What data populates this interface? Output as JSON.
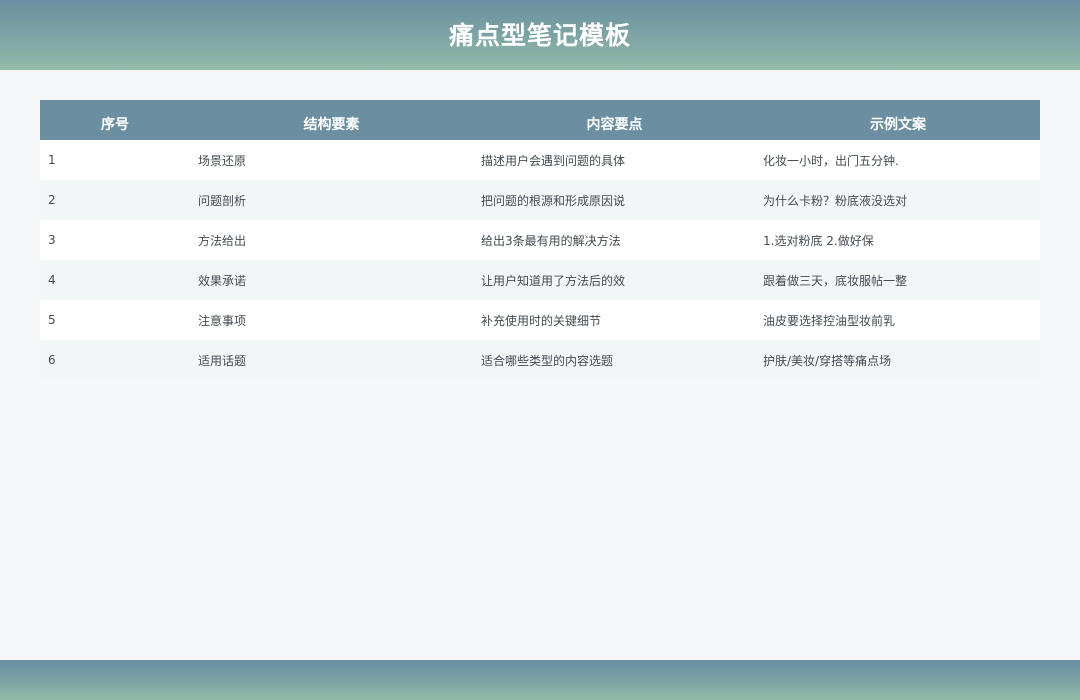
{
  "title": "痛点型笔记模板",
  "table": {
    "headers": [
      "序号",
      "结构要素",
      "内容要点",
      "示例文案"
    ],
    "rows": [
      [
        "1",
        "场景还原",
        "描述用户会遇到问题的具体",
        "化妆一小时，出门五分钟."
      ],
      [
        "2",
        "问题剖析",
        "把问题的根源和形成原因说",
        "为什么卡粉？粉底液没选对"
      ],
      [
        "3",
        "方法给出",
        "给出3条最有用的解决方法",
        "1.选对粉底 2.做好保"
      ],
      [
        "4",
        "效果承诺",
        "让用户知道用了方法后的效",
        "跟着做三天，底妆服帖一整"
      ],
      [
        "5",
        "注意事项",
        "补充使用时的关键细节",
        "油皮要选择控油型妆前乳"
      ],
      [
        "6",
        "适用话题",
        "适合哪些类型的内容选题",
        "护肤/美妆/穿搭等痛点场"
      ]
    ]
  },
  "colors": {
    "header_band": "#7fa6a4",
    "table_header": "#6b8ea1",
    "row_alt": "#f3f6f7",
    "background": "#f4f6f8"
  }
}
